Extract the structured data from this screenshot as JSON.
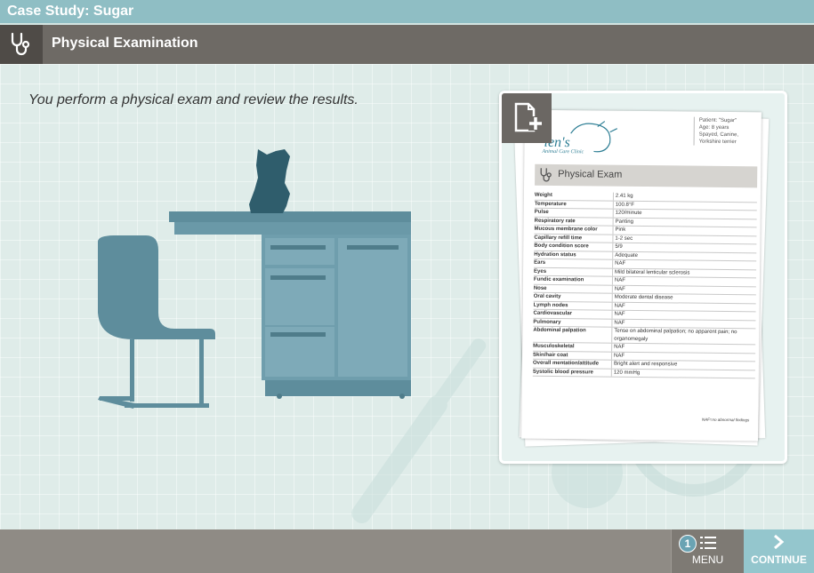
{
  "window": {
    "title": "Case Study: Sugar"
  },
  "section": {
    "title": "Physical Examination",
    "icon": "stethoscope-icon"
  },
  "main": {
    "intro": "You perform a physical exam and review the results."
  },
  "document": {
    "clinic_name": "Animal Care Clinic",
    "patient_lines": [
      "Patient: \"Sugar\"",
      "Age: 8 years",
      "Spayed, Canine,",
      "Yorkshire terrier"
    ],
    "heading": "Physical Exam",
    "rows": [
      {
        "k": "Weight",
        "v": "2.41 kg"
      },
      {
        "k": "Temperature",
        "v": "100.8°F"
      },
      {
        "k": "Pulse",
        "v": "120/minute"
      },
      {
        "k": "Respiratory rate",
        "v": "Panting"
      },
      {
        "k": "Mucous membrane color",
        "v": "Pink"
      },
      {
        "k": "Capillary refill time",
        "v": "1-2 sec"
      },
      {
        "k": "Body condition score",
        "v": "5/9"
      },
      {
        "k": "Hydration status",
        "v": "Adequate"
      },
      {
        "k": "Ears",
        "v": "NAF"
      },
      {
        "k": "Eyes",
        "v": "Mild bilateral lenticular sclerosis"
      },
      {
        "k": "Fundic examination",
        "v": "NAF"
      },
      {
        "k": "Nose",
        "v": "NAF"
      },
      {
        "k": "Oral cavity",
        "v": "Moderate dental disease"
      },
      {
        "k": "Lymph nodes",
        "v": "NAF"
      },
      {
        "k": "Cardiovascular",
        "v": "NAF"
      },
      {
        "k": "Pulmonary",
        "v": "NAF"
      },
      {
        "k": "Abdominal palpation",
        "v": "Tense on abdominal palpation; no apparent pain; no organomegaly"
      },
      {
        "k": "Musculoskeletal",
        "v": "NAF"
      },
      {
        "k": "Skin/hair coat",
        "v": "NAF"
      },
      {
        "k": "Overall mentation/attitude",
        "v": "Bright alert and responsive"
      },
      {
        "k": "Systolic blood pressure",
        "v": "120 mmHg"
      }
    ],
    "footnote": "NAF=no abnormal findings"
  },
  "footer": {
    "menu_badge": "1",
    "menu_label": "MENU",
    "continue_label": "CONTINUE"
  },
  "colors": {
    "accent": "#8fbec4",
    "header": "#6e6a65",
    "footer": "#8f8b85",
    "furniture": "#5e8d9c"
  }
}
